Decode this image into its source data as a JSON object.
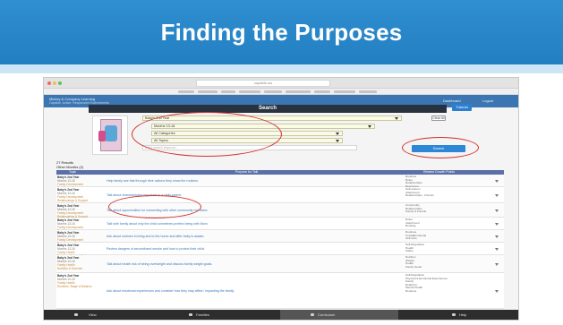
{
  "slide": {
    "title": "Finding the Purposes"
  },
  "browser": {
    "url": "capable.ws"
  },
  "app": {
    "name": "Mickey & Company Learning",
    "subtitle": "Capable, Active, Responsive Environments",
    "dashboard": "Dashboard",
    "logout": "Logout"
  },
  "search": {
    "heading": "Search",
    "help": "Tutorial",
    "clear": "Clear All",
    "button": "Search",
    "keyword_placeholder": "Enter search keyword...",
    "selects": [
      "Baby's 2nd Year",
      "Months 13-18",
      "All Categories",
      "All Topics"
    ]
  },
  "results": {
    "count": "27 Results",
    "filter": "Other Months (2)",
    "columns": {
      "topic": "Topic",
      "purpose": "Purpose for Talk",
      "dev": "Related Growth Points"
    },
    "rows": [
      {
        "title": "Baby's 2nd Year",
        "lines": [
          "Months 13-18",
          "Family Development",
          "Employment"
        ],
        "purpose": "Help family see that through their actions they show the routines.",
        "dev": [
          "Routines",
          "Roles",
          "Relationships",
          "Resources"
        ]
      },
      {
        "title": "Baby's 2nd Year",
        "lines": [
          "Months 13-18",
          "Family Development",
          "Relationships & Support"
        ],
        "purpose": "Talk about characteristics important in a child-parent.",
        "dev": [
          "Self-esteem",
          "Attachment",
          "Relationships - Friends"
        ]
      },
      {
        "title": "Baby's 2nd Year",
        "lines": [
          "Months 13-18",
          "Family Development",
          "Relationships & Support"
        ],
        "purpose": "Talk about opportunities for connecting with other community members.",
        "dev": [
          "Community",
          "Relationships",
          "Family & Friends"
        ]
      },
      {
        "title": "Baby's 2nd Year",
        "lines": [
          "Months 13-18",
          "Family Development",
          "Routines"
        ],
        "purpose": "Talk with family about why the child sometimes prefers being with Mom.",
        "dev": [
          "Roles",
          "Attachment",
          "Bonding"
        ]
      },
      {
        "title": "Baby's 2nd Year",
        "lines": [
          "Months 13-18",
          "Family Development",
          "Routines"
        ],
        "purpose": "Ask about routines in bring and to the home and after baby is awake.",
        "dev": [
          "Routines",
          "Social/Emotional",
          "Self Care"
        ]
      },
      {
        "title": "Baby's 2nd Year",
        "lines": [
          "Months 13-18",
          "Family Health",
          "Routines: Stage of Balance"
        ],
        "purpose": "Review dangers of secondhand smoke and how to protect their child.",
        "dev": [
          "Self-Regulation",
          "Health",
          "Safety"
        ]
      },
      {
        "title": "Baby's 2nd Year",
        "lines": [
          "Months 13-18",
          "Family Health",
          "Nutrition & Exercise"
        ],
        "purpose": "Talk about health risk of being overweight and discuss family weight goals.",
        "dev": [
          "Nutrition",
          "Weight",
          "Health",
          "Family Goals"
        ]
      },
      {
        "title": "Baby's 2nd Year",
        "lines": [
          "Months 13-18",
          "Family Health",
          "Routines: Stage of Balance"
        ],
        "purpose": "Ask about emotional experiences and consider how they may affect / impacting the family.",
        "dev": [
          "Self-Regulation",
          "Physical & Emotional Experiences",
          "Family",
          "Relations",
          "Mental Health",
          "Routines"
        ]
      }
    ]
  },
  "nav": {
    "items": [
      "View",
      "Families",
      "Curriculum",
      "Help"
    ],
    "active": 2
  }
}
